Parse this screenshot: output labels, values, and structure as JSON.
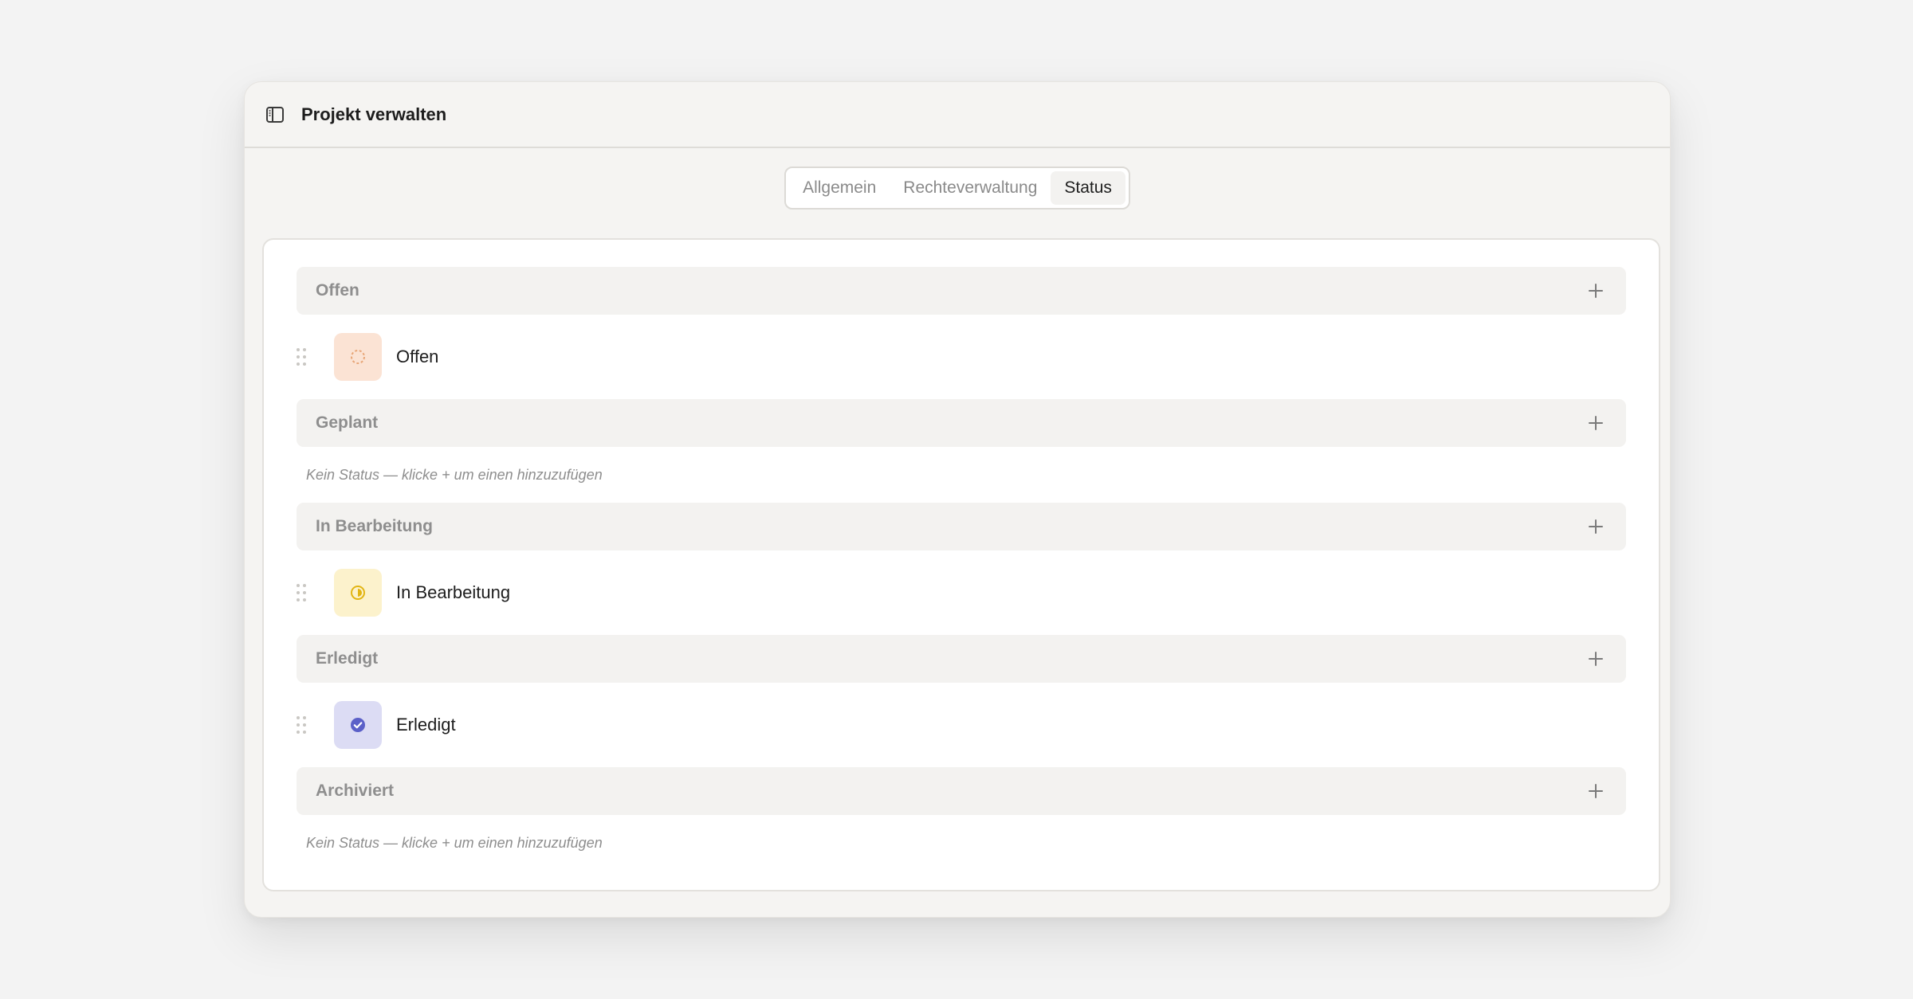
{
  "window": {
    "title": "Projekt verwalten",
    "sidebar_icon": "sidebar-toggle-icon"
  },
  "tabs": [
    {
      "label": "Allgemein",
      "active": false
    },
    {
      "label": "Rechteverwaltung",
      "active": false
    },
    {
      "label": "Status",
      "active": true
    }
  ],
  "groups": [
    {
      "label": "Offen",
      "add_icon": "plus-icon",
      "status": {
        "name": "Offen",
        "icon": "dashed-circle-icon",
        "bg": "#fbe3d4",
        "color": "#e8a779"
      }
    },
    {
      "label": "Geplant",
      "add_icon": "plus-icon",
      "empty_text": "Kein Status — klicke + um einen hinzuzufügen"
    },
    {
      "label": "In Bearbeitung",
      "add_icon": "plus-icon",
      "status": {
        "name": "In Bearbeitung",
        "icon": "half-circle-icon",
        "bg": "#fcf2cc",
        "color": "#e2b514"
      }
    },
    {
      "label": "Erledigt",
      "add_icon": "plus-icon",
      "status": {
        "name": "Erledigt",
        "icon": "check-circle-icon",
        "bg": "#dcdcf4",
        "color": "#5b60c8"
      }
    },
    {
      "label": "Archiviert",
      "add_icon": "plus-icon",
      "empty_text": "Kein Status — klicke + um einen hinzuzufügen"
    }
  ]
}
